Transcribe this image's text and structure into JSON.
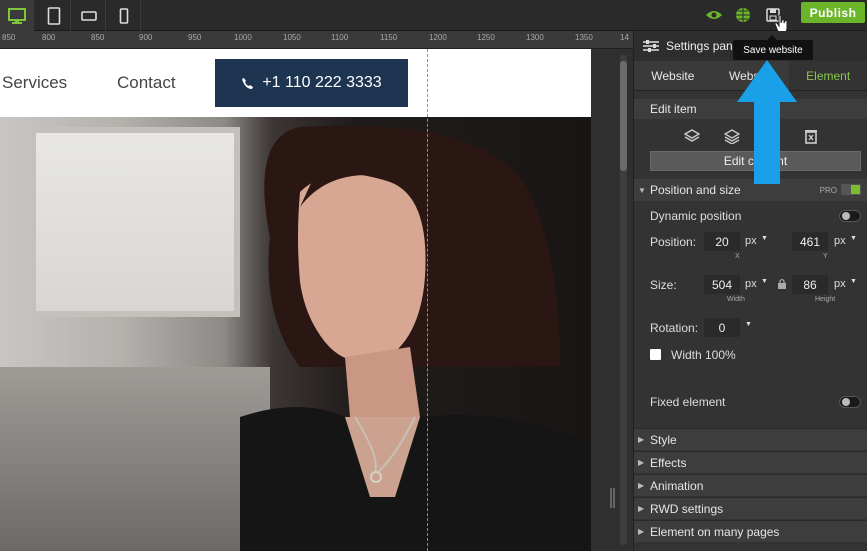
{
  "toolbar": {
    "devices": [
      "desktop-icon",
      "tablet-portrait-icon",
      "tablet-landscape-icon",
      "phone-icon"
    ],
    "publish_label": "Publish",
    "save_tooltip": "Save website",
    "accent_color": "#6bb52a"
  },
  "ruler": {
    "ticks": [
      "850",
      "800",
      "850",
      "900",
      "950",
      "1000",
      "1050",
      "1100",
      "1150",
      "1200",
      "1250",
      "1300",
      "1350",
      "14"
    ]
  },
  "canvas": {
    "nav": {
      "services": "Services",
      "contact": "Contact"
    },
    "phone_button": "+1 110 222 3333",
    "brand_color": "#1d3550"
  },
  "panel": {
    "title": "Settings pan",
    "tabs": [
      {
        "label": "Website"
      },
      {
        "label": "Website"
      },
      {
        "label": "Element",
        "active": true
      }
    ],
    "edit_item": {
      "title": "Edit item",
      "icons": [
        "layer-up-icon",
        "layer-down-icon",
        "copy-icon",
        "delete-icon"
      ],
      "edit_button": "Edit content"
    },
    "position_size": {
      "title": "Position and size",
      "pro_badge": "PRO",
      "dynamic_position": "Dynamic position",
      "position_label": "Position:",
      "x_value": "20",
      "x_unit": "px",
      "x_caption": "X",
      "y_value": "461",
      "y_unit": "px",
      "y_caption": "Y",
      "size_label": "Size:",
      "width_value": "504",
      "width_unit": "px",
      "width_caption": "Width",
      "height_value": "86",
      "height_unit": "px",
      "height_caption": "Height",
      "rotation_label": "Rotation:",
      "rotation_value": "0",
      "width100_label": "Width 100%",
      "fixed_label": "Fixed element"
    },
    "collapsed_sections": [
      "Style",
      "Effects",
      "Animation",
      "RWD settings",
      "Element on many pages"
    ]
  },
  "annotation": {
    "arrow_color": "#1aa0e8"
  }
}
